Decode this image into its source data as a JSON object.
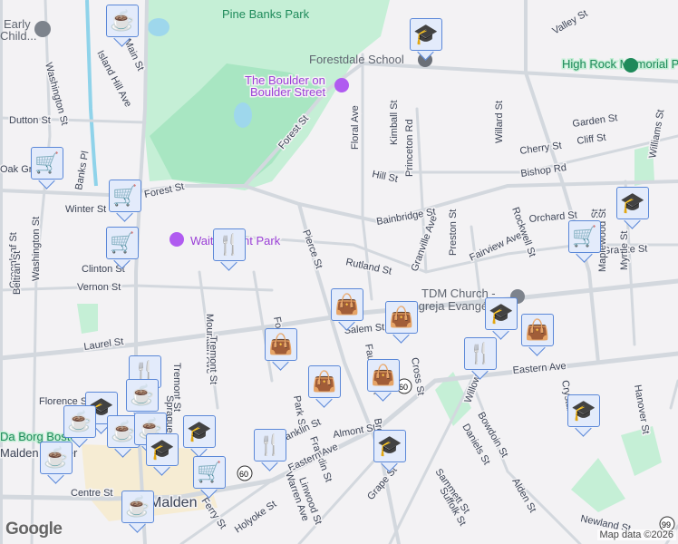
{
  "map": {
    "parks": [
      "Pine Banks Park",
      "High Rock Memorial Park"
    ],
    "places": {
      "boulder": [
        "The Boulder on",
        "Boulder Street"
      ],
      "school": "Forestdale School",
      "early": [
        "Early",
        "Child..."
      ],
      "waitt": "Waitt Mount Park",
      "church": [
        "TDM Church -",
        "Igreja Evangé..."
      ],
      "borg": "Da Borg Boston",
      "city": "Malden",
      "malden_center": "Malden Center"
    },
    "streets": [
      "Main St",
      "Island Hill Ave",
      "Washington St",
      "Dutton St",
      "Oak Grove",
      "Banks Pl",
      "Winter St",
      "Forest St",
      "Forest St",
      "Clinton St",
      "Vernon St",
      "Greenleaf St",
      "Beltran St",
      "Washington St",
      "Pierce St",
      "Floral Ave",
      "Kimball St",
      "Princeton Rd",
      "Hill St",
      "Bainbridge St",
      "Rutland St",
      "Granville Ave",
      "Preston St",
      "Fairview Ave",
      "Rockwell St",
      "Orchard St",
      "Willard St",
      "Cherry St",
      "Bishop Rd",
      "Garden St",
      "Cliff St",
      "Valley St",
      "Williams St",
      "Granite St",
      "Salem St",
      "Salem St",
      "Maplewood St",
      "Myrtle St",
      "Laurel St",
      "Mountain Ave",
      "Tremont St",
      "Tremont St",
      "Sprague St",
      "Park St",
      "Franklin St",
      "Franklin St",
      "Eastern Ave",
      "Eastern Ave",
      "Linwood St",
      "Warren Ave",
      "Holyoke St",
      "Ferry St",
      "Centre St",
      "Florence St",
      "Faulkner St",
      "Cross St",
      "Willow St",
      "Bowdoin St",
      "Daniels St",
      "Sammett St",
      "Suffolk St",
      "Alden St",
      "Newland St",
      "Crystal St",
      "Hanover St",
      "Grape St",
      "Almont St",
      "Broadway",
      "Forest St"
    ],
    "route_shields": [
      "60",
      "60",
      "99"
    ],
    "markers": [
      "cafe",
      "school",
      "cart",
      "cart",
      "cart",
      "restaurant",
      "school",
      "cart",
      "bag",
      "bag",
      "school",
      "bag",
      "restaurant",
      "bag",
      "bag",
      "bag",
      "school",
      "school",
      "restaurant",
      "restaurant",
      "cafe",
      "school",
      "cafe",
      "cafe",
      "cafe",
      "school",
      "school",
      "cart",
      "cafe",
      "cafe"
    ],
    "logo": "Google",
    "attribution": "Map data ©2026"
  }
}
